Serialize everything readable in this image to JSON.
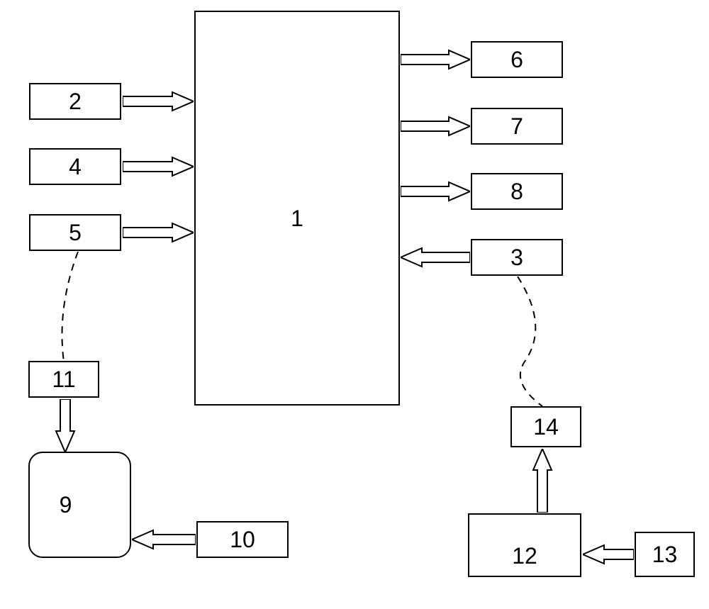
{
  "blocks": {
    "center": "1",
    "left_1": "2",
    "left_2": "4",
    "left_3": "5",
    "right_1": "6",
    "right_2": "7",
    "right_3": "8",
    "right_4": "3",
    "bottom_left_1": "11",
    "bottom_left_main": "9",
    "bottom_left_2": "10",
    "bottom_right_1": "14",
    "bottom_right_main": "12",
    "bottom_right_2": "13"
  }
}
